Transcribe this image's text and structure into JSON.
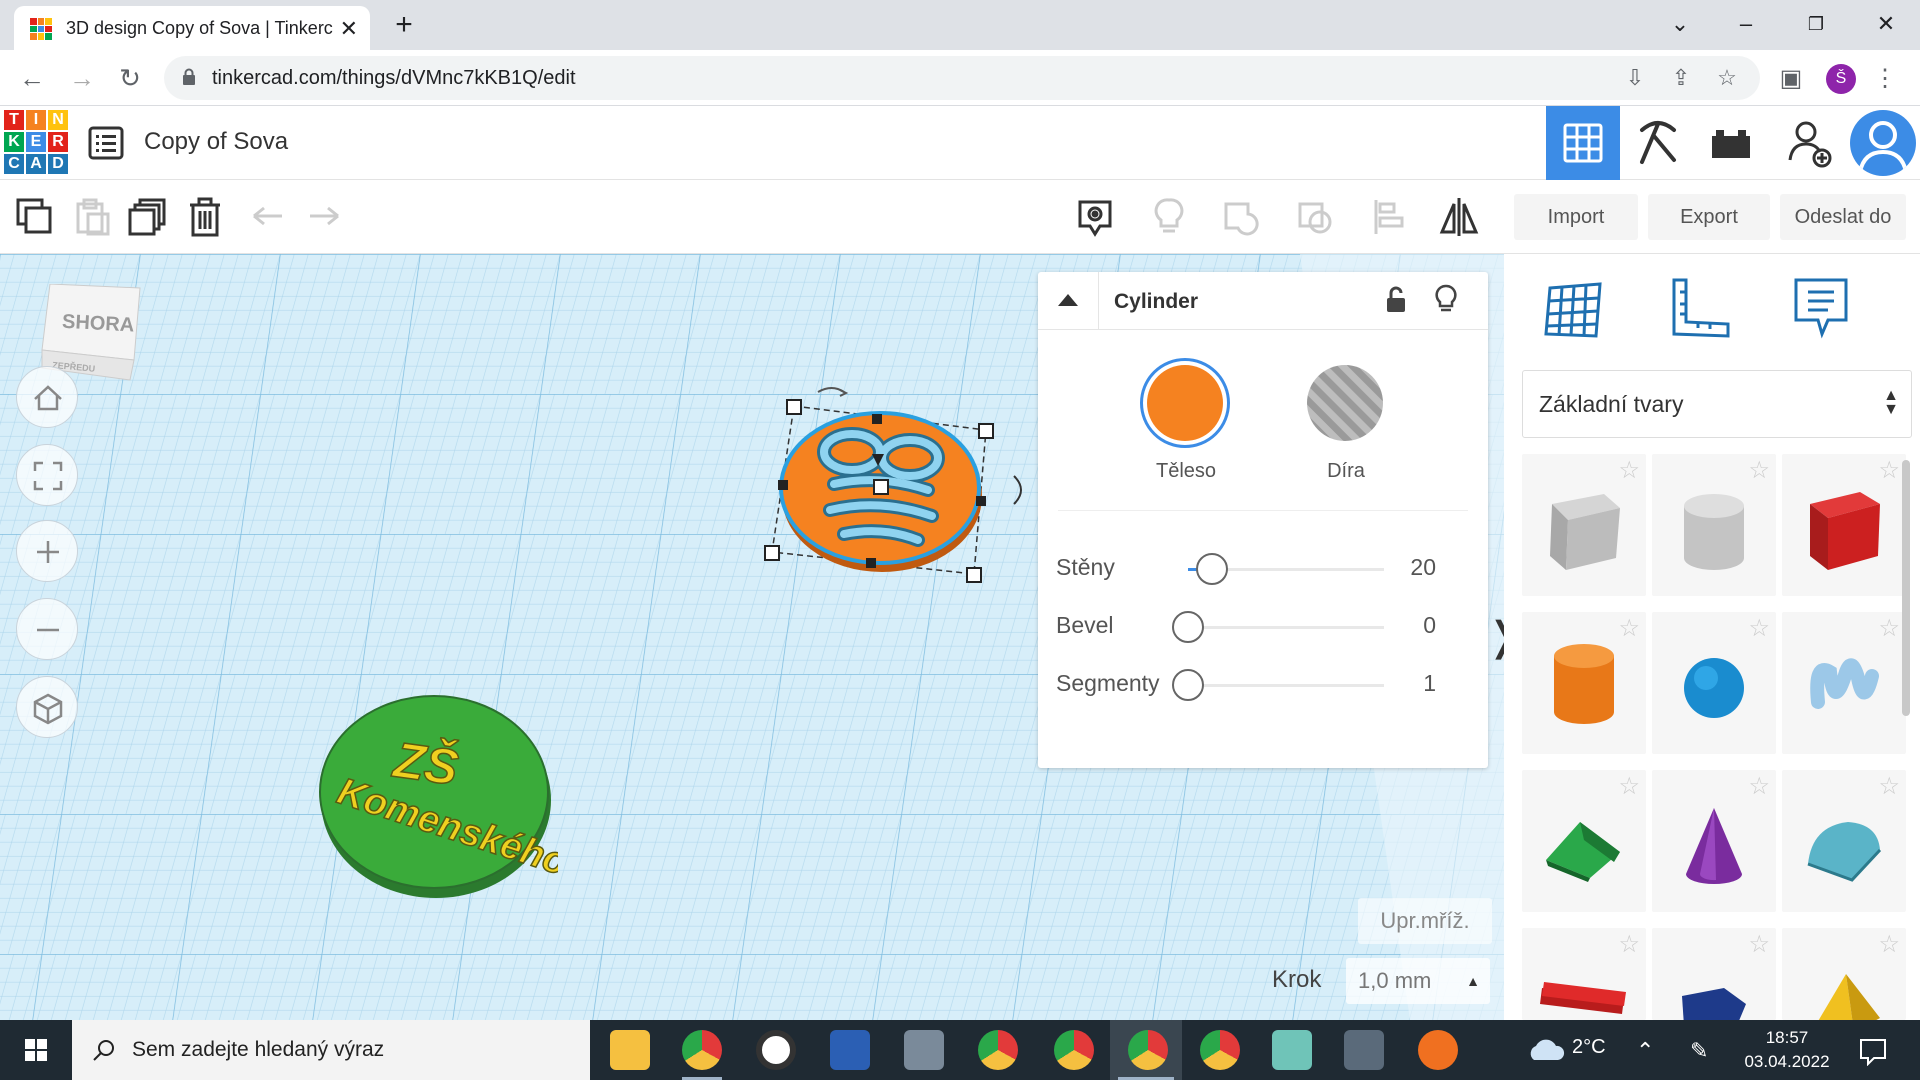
{
  "browser": {
    "tab_title": "3D design Copy of Sova | Tinkerc",
    "url": "tinkercad.com/things/dVMnc7kKB1Q/edit",
    "profile_initial": "Š"
  },
  "app": {
    "logo_letters": [
      "T",
      "I",
      "N",
      "K",
      "E",
      "R",
      "C",
      "A",
      "D"
    ],
    "design_name": "Copy of Sova"
  },
  "toolbar": {
    "import_label": "Import",
    "export_label": "Export",
    "send_label": "Odeslat do"
  },
  "viewcube": {
    "top_label": "SHORA",
    "front_label": "ZEPŘEDU"
  },
  "inspector": {
    "title": "Cylinder",
    "solid_label": "Těleso",
    "hole_label": "Díra",
    "solid_color": "#f58220",
    "props": [
      {
        "label": "Stěny",
        "value": "20",
        "level": 0.1
      },
      {
        "label": "Bevel",
        "value": "0",
        "level": 0
      },
      {
        "label": "Segmenty",
        "value": "1",
        "level": 0
      }
    ]
  },
  "workplane": {
    "edit_grid_label": "Upr.mříž.",
    "step_label": "Krok",
    "step_value": "1,0 mm",
    "green_disc_text_1": "ZŠ",
    "green_disc_text_2": "Komenského"
  },
  "shapes_panel": {
    "category": "Základní tvary"
  },
  "taskbar": {
    "search_placeholder": "Sem zadejte hledaný výraz",
    "temperature": "2°C",
    "time": "18:57",
    "date": "03.04.2022"
  }
}
